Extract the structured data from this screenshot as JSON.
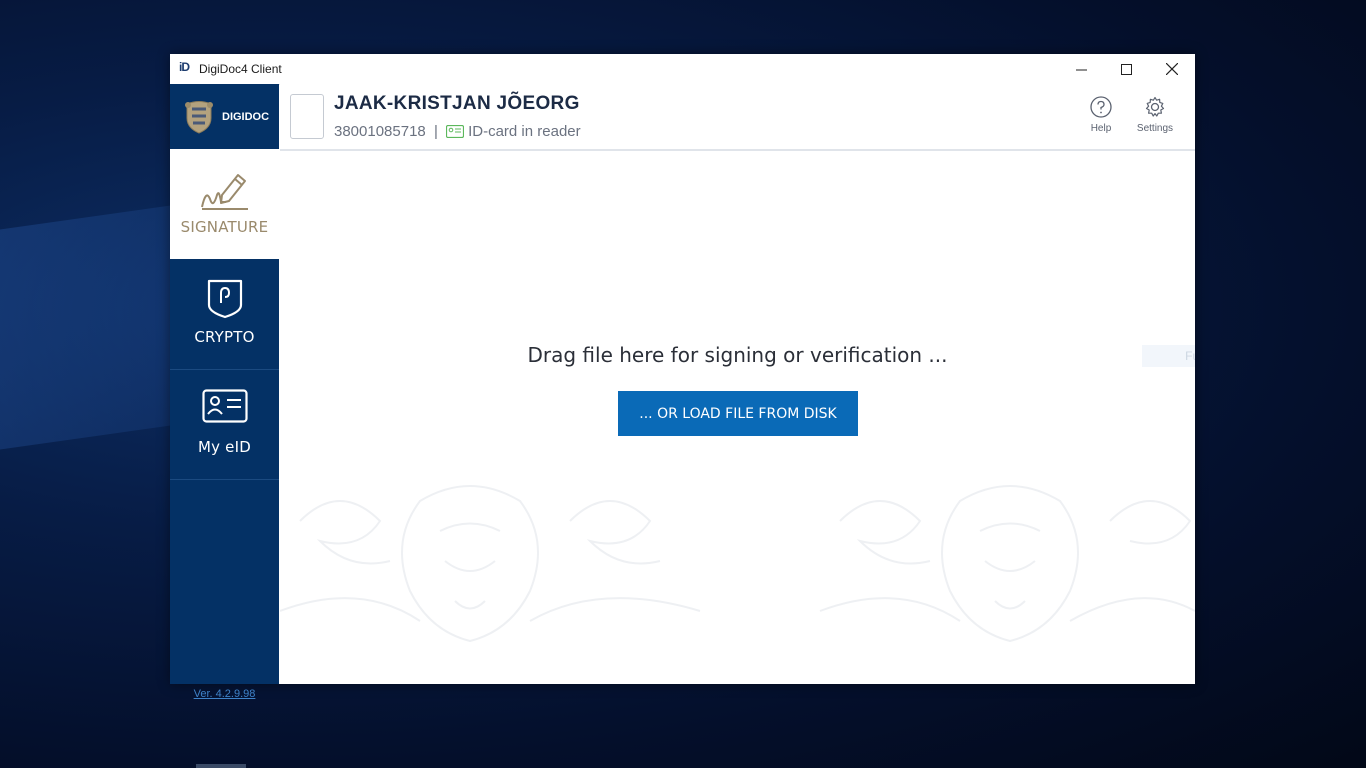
{
  "window": {
    "title": "DigiDoc4 Client",
    "app_icon_text": "iD"
  },
  "sidebar": {
    "logo_text": "DIGIDOC",
    "items": [
      {
        "label": "SIGNATURE",
        "icon": "signature-pen-icon",
        "active": true
      },
      {
        "label": "CRYPTO",
        "icon": "shield-lock-icon",
        "active": false
      },
      {
        "label": "My eID",
        "icon": "id-card-icon",
        "active": false
      }
    ],
    "version": "Ver. 4.2.9.98"
  },
  "header": {
    "user_name": "JAAK-KRISTJAN JÕEORG",
    "personal_code": "38001085718",
    "separator": "|",
    "card_status": "ID-card in reader",
    "help_label": "Help",
    "settings_label": "Settings"
  },
  "main": {
    "drop_text": "Drag file here for signing or verification ...",
    "load_button": "... OR LOAD FILE FROM DISK"
  },
  "overlay": {
    "snip_text": "Full-screen Snip"
  },
  "colors": {
    "sidebar_bg": "#043165",
    "accent_gold": "#9a8a6c",
    "button_blue": "#0a6ab7",
    "status_green": "#5cb85c"
  }
}
